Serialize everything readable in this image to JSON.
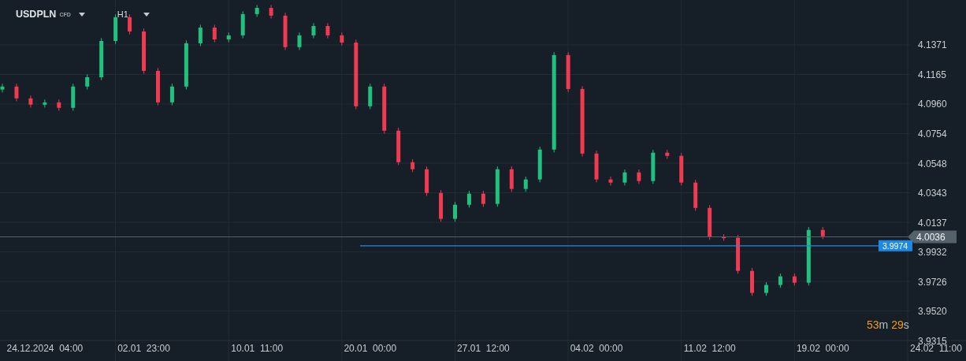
{
  "header": {
    "symbol": "USDPLN",
    "instrument_type": "CFD",
    "timeframe": "H1"
  },
  "chart": {
    "chart_data": {
      "type": "candlestick",
      "grid": true,
      "ylim": [
        3.9315,
        4.1683
      ],
      "categories": [
        null,
        null,
        null,
        "24.12.2024  04:00",
        null,
        null,
        null,
        null,
        null,
        null,
        "02.01  23:00",
        null,
        null,
        null,
        null,
        null,
        null,
        null,
        "10.01  11:00",
        null,
        null,
        null,
        null,
        null,
        null,
        null,
        "20.01  00:00",
        null,
        null,
        null,
        null,
        null,
        null,
        null,
        "27.01  12:00",
        null,
        null,
        null,
        null,
        null,
        null,
        null,
        "04.02  00:00",
        null,
        null,
        null,
        null,
        null,
        null,
        null,
        "11.02  12:00",
        null,
        null,
        null,
        null,
        null,
        null,
        null,
        "19.02  00:00",
        null,
        null,
        null,
        null,
        null,
        null,
        null,
        "24.02  11:00"
      ],
      "ohlc": [
        [
          4.106,
          4.1101,
          4.104,
          4.1081
        ],
        [
          4.1081,
          4.1101,
          4.0979,
          4.0999
        ],
        [
          4.0999,
          4.1019,
          4.0935,
          4.0955
        ],
        [
          4.0955,
          4.0991,
          4.0935,
          4.0971
        ],
        [
          4.0971,
          4.0991,
          4.0913,
          4.0933
        ],
        [
          4.0933,
          4.1101,
          4.0913,
          4.1081
        ],
        [
          4.1081,
          4.1166,
          4.1061,
          4.1146
        ],
        [
          4.1146,
          4.1418,
          4.1126,
          4.1398
        ],
        [
          4.1398,
          4.1583,
          4.1378,
          4.1563
        ],
        [
          4.1563,
          4.1583,
          4.1444,
          4.1464
        ],
        [
          4.1464,
          4.1484,
          4.117,
          4.119
        ],
        [
          4.119,
          4.121,
          4.0951,
          4.0971
        ],
        [
          4.0971,
          4.1101,
          4.0951,
          4.1081
        ],
        [
          4.1081,
          4.1402,
          4.1061,
          4.1382
        ],
        [
          4.1382,
          4.1511,
          4.1362,
          4.1491
        ],
        [
          4.1491,
          4.1511,
          4.1389,
          4.1409
        ],
        [
          4.1409,
          4.1457,
          4.1389,
          4.1437
        ],
        [
          4.1437,
          4.1605,
          4.1417,
          4.1585
        ],
        [
          4.1585,
          4.1648,
          4.1565,
          4.1628
        ],
        [
          4.1628,
          4.1648,
          4.1554,
          4.1574
        ],
        [
          4.1574,
          4.1594,
          4.1335,
          4.1355
        ],
        [
          4.1355,
          4.1457,
          4.1335,
          4.1437
        ],
        [
          4.1437,
          4.1522,
          4.1417,
          4.1502
        ],
        [
          4.1502,
          4.1522,
          4.1417,
          4.1437
        ],
        [
          4.1437,
          4.1457,
          4.1367,
          4.1387
        ],
        [
          4.1387,
          4.1407,
          4.0924,
          4.0944
        ],
        [
          4.0944,
          4.1101,
          4.0924,
          4.1081
        ],
        [
          4.1081,
          4.1101,
          4.0754,
          4.0774
        ],
        [
          4.0774,
          4.0794,
          4.0535,
          4.0555
        ],
        [
          4.0555,
          4.0575,
          4.0486,
          4.0506
        ],
        [
          4.0506,
          4.0526,
          4.0321,
          4.0341
        ],
        [
          4.0341,
          4.0361,
          4.0141,
          4.0161
        ],
        [
          4.0161,
          4.0279,
          4.0141,
          4.0259
        ],
        [
          4.0259,
          4.0356,
          4.0239,
          4.0336
        ],
        [
          4.0336,
          4.0356,
          4.0245,
          4.0265
        ],
        [
          4.0265,
          4.0526,
          4.0245,
          4.0506
        ],
        [
          4.0506,
          4.0526,
          4.0349,
          4.0369
        ],
        [
          4.0369,
          4.0455,
          4.0349,
          4.0435
        ],
        [
          4.0435,
          4.0663,
          4.0415,
          4.0643
        ],
        [
          4.0643,
          4.132,
          4.0623,
          4.13
        ],
        [
          4.13,
          4.132,
          4.1044,
          4.1064
        ],
        [
          4.1064,
          4.1084,
          4.0595,
          4.0615
        ],
        [
          4.0615,
          4.0635,
          4.0415,
          4.0435
        ],
        [
          4.0435,
          4.0455,
          4.0393,
          4.0413
        ],
        [
          4.0413,
          4.0504,
          4.0393,
          4.0484
        ],
        [
          4.0484,
          4.0504,
          4.0404,
          4.0424
        ],
        [
          4.0424,
          4.0641,
          4.0404,
          4.0621
        ],
        [
          4.0621,
          4.0641,
          4.0579,
          4.0599
        ],
        [
          4.0599,
          4.0619,
          4.0393,
          4.0413
        ],
        [
          4.0413,
          4.0433,
          4.0217,
          4.0237
        ],
        [
          4.0237,
          4.0257,
          4.0015,
          4.0035
        ],
        [
          4.0035,
          4.0055,
          4.0009,
          4.0029
        ],
        [
          4.0029,
          4.0049,
          3.9779,
          3.9799
        ],
        [
          3.9799,
          3.9819,
          3.9626,
          3.9646
        ],
        [
          3.9646,
          3.9721,
          3.9626,
          3.9701
        ],
        [
          3.9701,
          3.9781,
          3.9681,
          3.9761
        ],
        [
          3.9761,
          3.9781,
          3.9697,
          3.9717
        ],
        [
          3.9717,
          4.0104,
          3.9697,
          4.0084
        ],
        [
          4.0084,
          4.0104,
          4.002,
          4.004
        ],
        null,
        null,
        null,
        null,
        null,
        null,
        null,
        null
      ],
      "yticks": [
        {
          "value": 4.1371,
          "label": "4.1371"
        },
        {
          "value": 4.1165,
          "label": "4.1165"
        },
        {
          "value": 4.096,
          "label": "4.0960"
        },
        {
          "value": 4.0754,
          "label": "4.0754"
        },
        {
          "value": 4.0548,
          "label": "4.0548"
        },
        {
          "value": 4.0343,
          "label": "4.0343"
        },
        {
          "value": 4.0137,
          "label": "4.0137"
        },
        {
          "value": 3.9932,
          "label": "3.9932"
        },
        {
          "value": 3.9726,
          "label": "3.9726"
        },
        {
          "value": 3.952,
          "label": "3.9520"
        },
        {
          "value": 3.9315,
          "label": "3.9315"
        }
      ],
      "ref_lines": [
        {
          "axis": "y",
          "value": 4.0036,
          "label": "4.0036",
          "color": "#55616a"
        },
        {
          "axis": "y",
          "value": 3.9974,
          "label": "3.9974",
          "color": "#1e88e5"
        }
      ]
    }
  },
  "countdown": {
    "minutes": "53",
    "minutes_unit": "m",
    "seconds": "29",
    "seconds_unit": "s"
  }
}
